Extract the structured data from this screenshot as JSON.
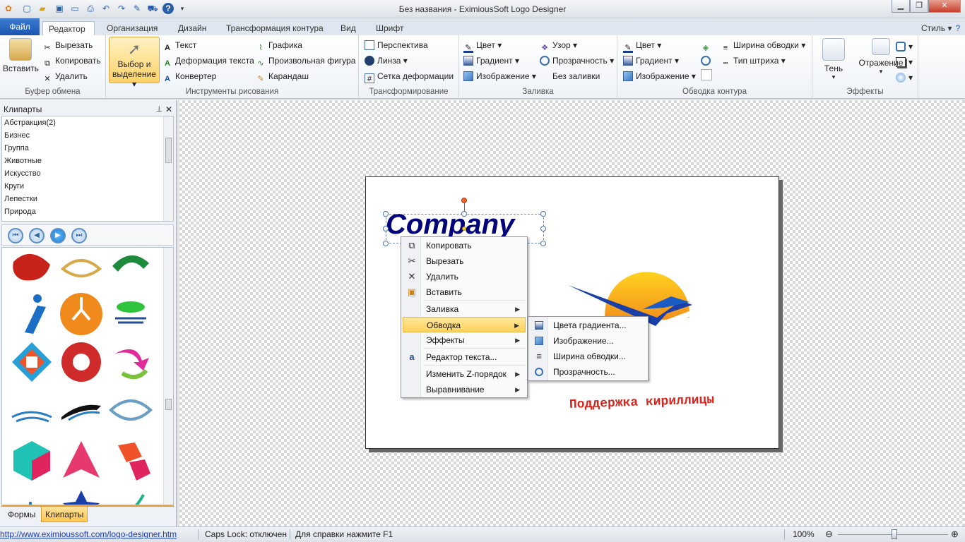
{
  "window": {
    "title": "Без названия - EximiousSoft Logo Designer",
    "style_label": "Стиль"
  },
  "tabs": {
    "file": "Файл",
    "editor": "Редактор",
    "organize": "Организация",
    "design": "Дизайн",
    "transform_path": "Трансформация контура",
    "view": "Вид",
    "font": "Шрифт"
  },
  "ribbon": {
    "clipboard": {
      "label": "Буфер обмена",
      "paste": "Вставить",
      "cut": "Вырезать",
      "copy": "Копировать",
      "delete": "Удалить"
    },
    "drawing": {
      "label": "Инструменты рисования",
      "select_line1": "Выбор и",
      "select_line2": "выделение",
      "text": "Текст",
      "text_deform": "Деформация текста",
      "converter": "Конвертер",
      "graphics": "Графика",
      "freeform": "Произвольная фигура",
      "pencil": "Карандаш"
    },
    "transform": {
      "label": "Трансформирование",
      "perspective": "Перспектива",
      "lens": "Линза",
      "deform_grid": "Сетка деформации"
    },
    "fill": {
      "label": "Заливка",
      "color": "Цвет",
      "gradient": "Градиент",
      "image": "Изображение",
      "pattern": "Узор",
      "transparency": "Прозрачность",
      "no_fill": "Без заливки"
    },
    "stroke": {
      "label": "Обводка контура",
      "color": "Цвет",
      "gradient": "Градиент",
      "image": "Изображение",
      "stroke_width": "Ширина обводки",
      "dash_type": "Тип штриха"
    },
    "effects": {
      "label": "Эффекты",
      "shadow": "Тень",
      "reflection": "Отражение"
    }
  },
  "sidebar": {
    "title": "Клипарты",
    "categories": [
      "Абстракция(2)",
      "Бизнес",
      "Группа",
      "Животные",
      "Искусство",
      "Круги",
      "Лепестки",
      "Природа"
    ],
    "bottom_tabs": [
      "Формы",
      "Клипарты"
    ]
  },
  "canvas": {
    "company_text": "Company",
    "cyrillic_text": "Поддержка кириллицы"
  },
  "context_menu": {
    "copy": "Копировать",
    "cut": "Вырезать",
    "delete": "Удалить",
    "paste": "Вставить",
    "fill": "Заливка",
    "stroke": "Обводка",
    "effects": "Эффекты",
    "text_editor": "Редактор текста...",
    "z_order": "Изменить Z-порядок",
    "align": "Выравнивание"
  },
  "submenu": {
    "gradient_colors": "Цвета градиента...",
    "image": "Изображение...",
    "stroke_width": "Ширина обводки...",
    "transparency": "Прозрачность..."
  },
  "status": {
    "url": "http://www.eximioussoft.com/logo-designer.htm",
    "caps": "Caps Lock: отключен",
    "help": "Для справки нажмите F1",
    "zoom": "100%"
  },
  "colors": {
    "accent": "#1a56b0",
    "highlight": "#ffd25a",
    "company_text": "#00007a",
    "cyrillic_text": "#d8261e"
  },
  "icons": [
    "app-icon",
    "new-icon",
    "open-icon",
    "save-icon",
    "print-icon",
    "undo-icon",
    "redo-icon",
    "cart-icon",
    "help-icon",
    "minimize-icon",
    "maximize-icon",
    "close-icon",
    "paste-icon",
    "scissors-icon",
    "copy-icon",
    "delete-icon",
    "cursor-icon",
    "text-icon",
    "pencil-icon",
    "lens-icon",
    "gradient-icon",
    "image-icon",
    "transparency-icon",
    "stroke-width-icon",
    "dash-icon",
    "shadow-icon",
    "reflection-icon",
    "pin-icon",
    "first-icon",
    "prev-icon",
    "play-icon",
    "last-icon"
  ]
}
